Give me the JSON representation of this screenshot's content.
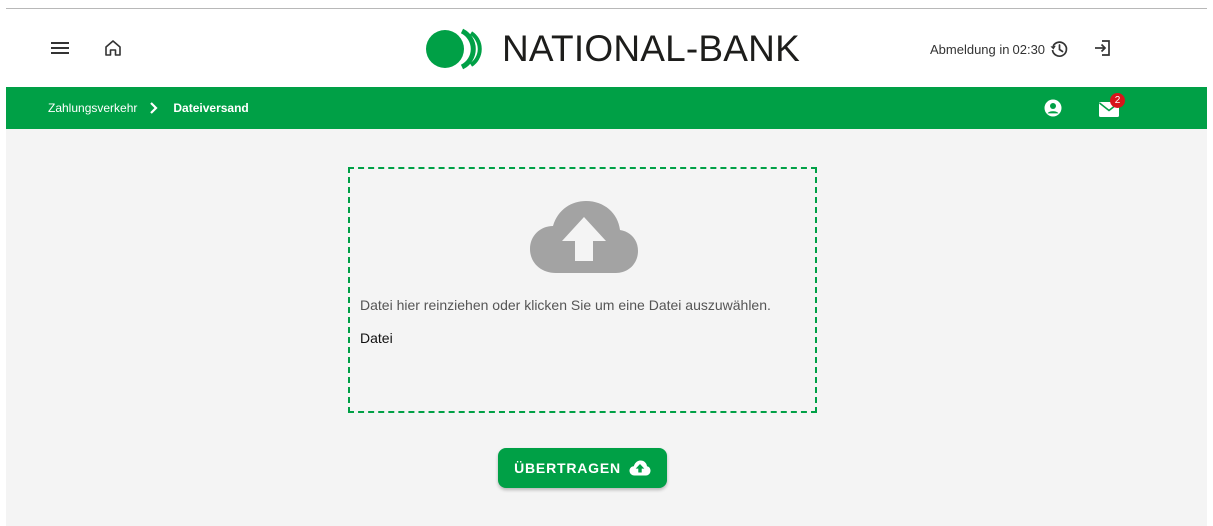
{
  "brand": {
    "name": "NATIONAL-BANK",
    "color": "#00a046"
  },
  "header": {
    "menu_icon": "hamburger-menu-icon",
    "home_icon": "home-icon",
    "session_label": "Abmeldung in",
    "session_time": "02:30",
    "history_icon": "history-icon",
    "logout_icon": "logout-icon"
  },
  "breadcrumb": {
    "items": [
      "Zahlungsverkehr",
      "Dateiversand"
    ],
    "separator_icon": "chevron-right-icon"
  },
  "toolbar": {
    "user_icon": "user-circle-icon",
    "mail_icon": "envelope-icon",
    "mail_badge": "2",
    "badge_color": "#d8141b"
  },
  "upload": {
    "icon": "cloud-upload-icon",
    "hint": "Datei hier reinziehen oder klicken Sie um eine Datei auszuwählen.",
    "file_label": "Datei"
  },
  "actions": {
    "submit_label": "ÜBERTRAGEN",
    "submit_icon": "cloud-upload-icon"
  }
}
